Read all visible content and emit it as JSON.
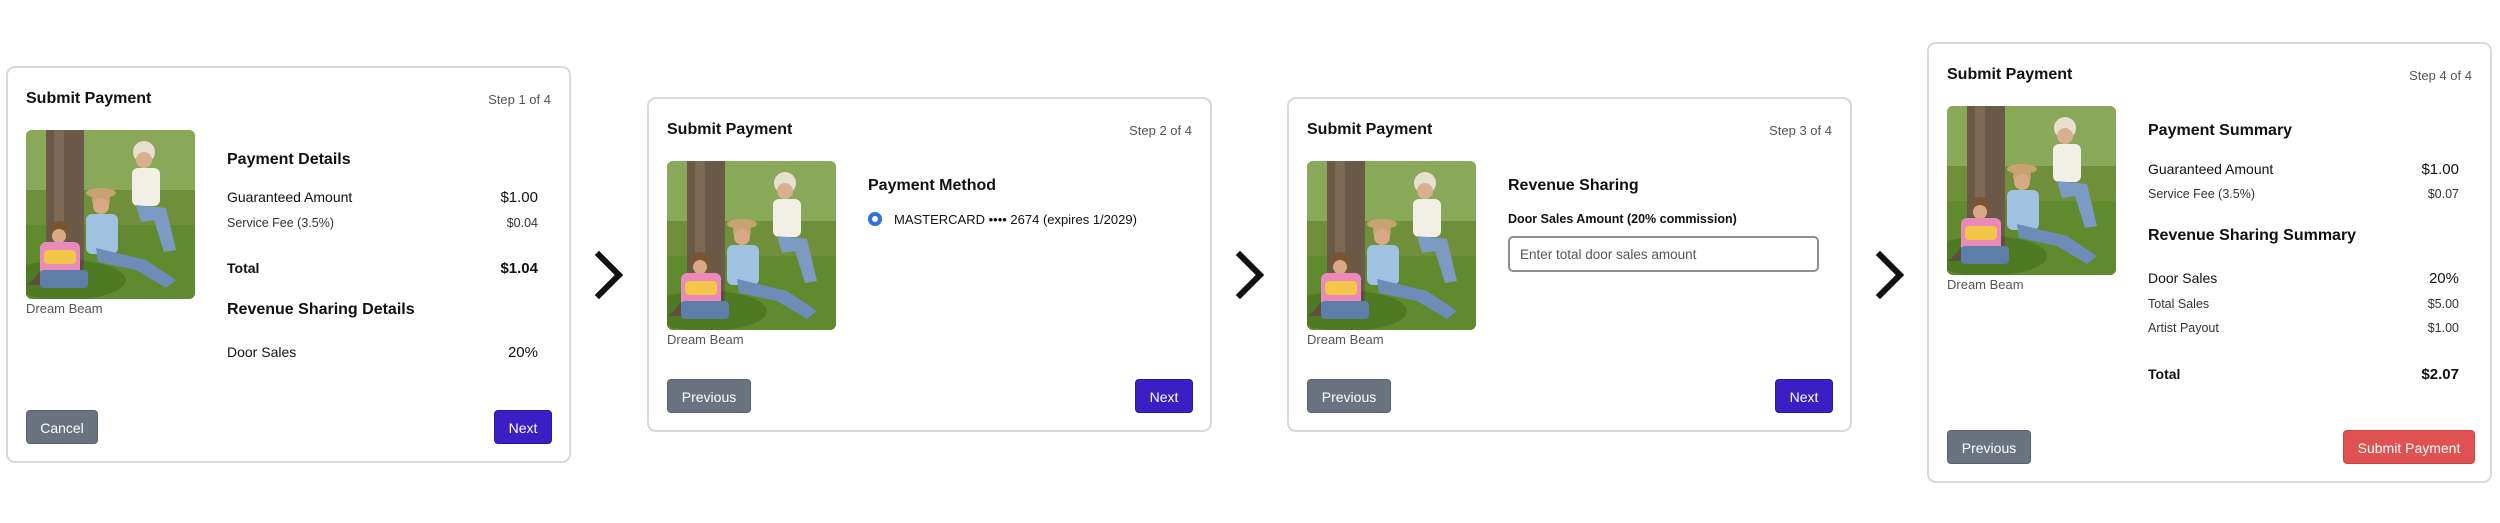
{
  "cards": [
    {
      "title": "Submit Payment",
      "step": "Step 1 of 4",
      "caption": "Dream Beam",
      "payment_details": {
        "heading": "Payment Details",
        "guaranteed_label": "Guaranteed Amount",
        "guaranteed_value": "$1.00",
        "fee_label": "Service Fee (3.5%)",
        "fee_value": "$0.04",
        "total_label": "Total",
        "total_value": "$1.04"
      },
      "revenue_details": {
        "heading": "Revenue Sharing Details",
        "door_label": "Door Sales",
        "door_value": "20%"
      },
      "left_button": "Cancel",
      "right_button": "Next"
    },
    {
      "title": "Submit Payment",
      "step": "Step 2 of 4",
      "caption": "Dream Beam",
      "method_heading": "Payment Method",
      "method_option": "MASTERCARD •••• 2674 (expires 1/2029)",
      "left_button": "Previous",
      "right_button": "Next"
    },
    {
      "title": "Submit Payment",
      "step": "Step 3 of 4",
      "caption": "Dream Beam",
      "revenue_heading": "Revenue Sharing",
      "field_label": "Door Sales Amount (20% commission)",
      "field_placeholder": "Enter total door sales amount",
      "field_value": "",
      "left_button": "Previous",
      "right_button": "Next"
    },
    {
      "title": "Submit Payment",
      "step": "Step 4 of 4",
      "caption": "Dream Beam",
      "summary_heading": "Payment Summary",
      "guaranteed_label": "Guaranteed Amount",
      "guaranteed_value": "$1.00",
      "fee_label": "Service Fee (3.5%)",
      "fee_value": "$0.07",
      "revenue_summary_heading": "Revenue Sharing Summary",
      "door_label": "Door Sales",
      "door_value": "20%",
      "total_sales_label": "Total Sales",
      "total_sales_value": "$5.00",
      "artist_payout_label": "Artist Payout",
      "artist_payout_value": "$1.00",
      "total_label": "Total",
      "total_value": "$2.07",
      "left_button": "Previous",
      "right_button": "Submit Payment"
    }
  ],
  "icons": {
    "step_arrow": "chevron-right-icon",
    "radio": "radio-selected-icon"
  },
  "colors": {
    "primary_button": "#3b1fc4",
    "secondary_button": "#6b7280",
    "submit_button": "#e05252",
    "radio_selected": "#2f6fe0",
    "card_border": "#d9d9dc"
  }
}
